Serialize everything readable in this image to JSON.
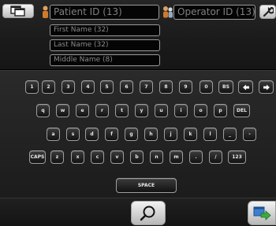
{
  "fields": {
    "patient_id": "Patient ID (13)",
    "operator_id": "Operator ID (13)",
    "first_name": "First Name (32)",
    "last_name": "Last Name (32)",
    "middle_name": "Middle Name (8)"
  },
  "keyboard": {
    "row1": [
      "1",
      "2",
      "3",
      "4",
      "5",
      "6",
      "7",
      "8",
      "9",
      "0",
      "BS"
    ],
    "row2": [
      "q",
      "w",
      "e",
      "r",
      "t",
      "y",
      "u",
      "i",
      "o",
      "p",
      "DEL"
    ],
    "row3": [
      "a",
      "s",
      "d",
      "f",
      "g",
      "h",
      "j",
      "k",
      "l",
      "_",
      "-"
    ],
    "row4": [
      "CAPS",
      "z",
      "x",
      "c",
      "v",
      "b",
      "n",
      "m",
      ".",
      "/",
      "123"
    ],
    "space": "SPACE"
  },
  "icons": {
    "top_left": "windows-icon",
    "patient": "patient-icon",
    "operator": "operator-icon",
    "settings": "wrench-icon",
    "arrow_left": "arrow-left-icon",
    "arrow_right": "arrow-right-icon",
    "search": "search-icon",
    "next": "next-screen-icon"
  },
  "colors": {
    "background": "#000000",
    "field_border": "#9a9a9a",
    "placeholder_text": "#8a8a8a",
    "key_face": "#1e1e1e",
    "accent_orange": "#d98a2a",
    "accent_blue": "#3b7fd0",
    "accent_green": "#3faa3f"
  }
}
